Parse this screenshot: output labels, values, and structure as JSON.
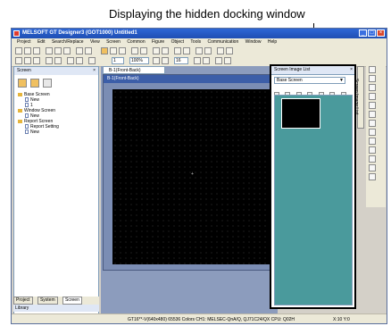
{
  "callout": {
    "text": "Displaying the hidden docking window"
  },
  "window": {
    "title": "MELSOFT GT Designer3 (GOT1000) Untitled1",
    "controls": [
      "_",
      "□",
      "×"
    ]
  },
  "menu": [
    "Project",
    "Edit",
    "Search/Replace",
    "View",
    "Screen",
    "Common",
    "Figure",
    "Object",
    "Tools",
    "Communication",
    "Window",
    "Help"
  ],
  "toolbar": {
    "zoom_value": "100%",
    "line_width": "1",
    "scale": "16"
  },
  "screen_panel": {
    "title": "Screen",
    "close": "×",
    "tree": [
      {
        "label": "Base Screen",
        "type": "folder"
      },
      {
        "label": "New",
        "type": "item"
      },
      {
        "label": "1",
        "type": "item"
      },
      {
        "label": "Window Screen",
        "type": "folder"
      },
      {
        "label": "New",
        "type": "item"
      },
      {
        "label": "Report Screen",
        "type": "folder"
      },
      {
        "label": "Report Setting",
        "type": "item"
      },
      {
        "label": "New",
        "type": "item"
      }
    ]
  },
  "editor": {
    "tab_label": "B-1(Front-Back)",
    "title": "B-1(Front-Back)",
    "crosshair": "+"
  },
  "screen_image_list": {
    "title": "Screen Image List",
    "close": "×",
    "select_value": "Base Screen",
    "select_arrow": "▼",
    "tab_label": "Screen Image List"
  },
  "bottom_tabs": [
    "Project",
    "System",
    "Screen"
  ],
  "library_label": "Library",
  "status": {
    "text": "GT16**-V(640x480) 65536 Colors CH1: MELSEC-QnA/Q, QJ71C24/QX CPU: Q02H",
    "coords": "X:10 Y:0"
  }
}
